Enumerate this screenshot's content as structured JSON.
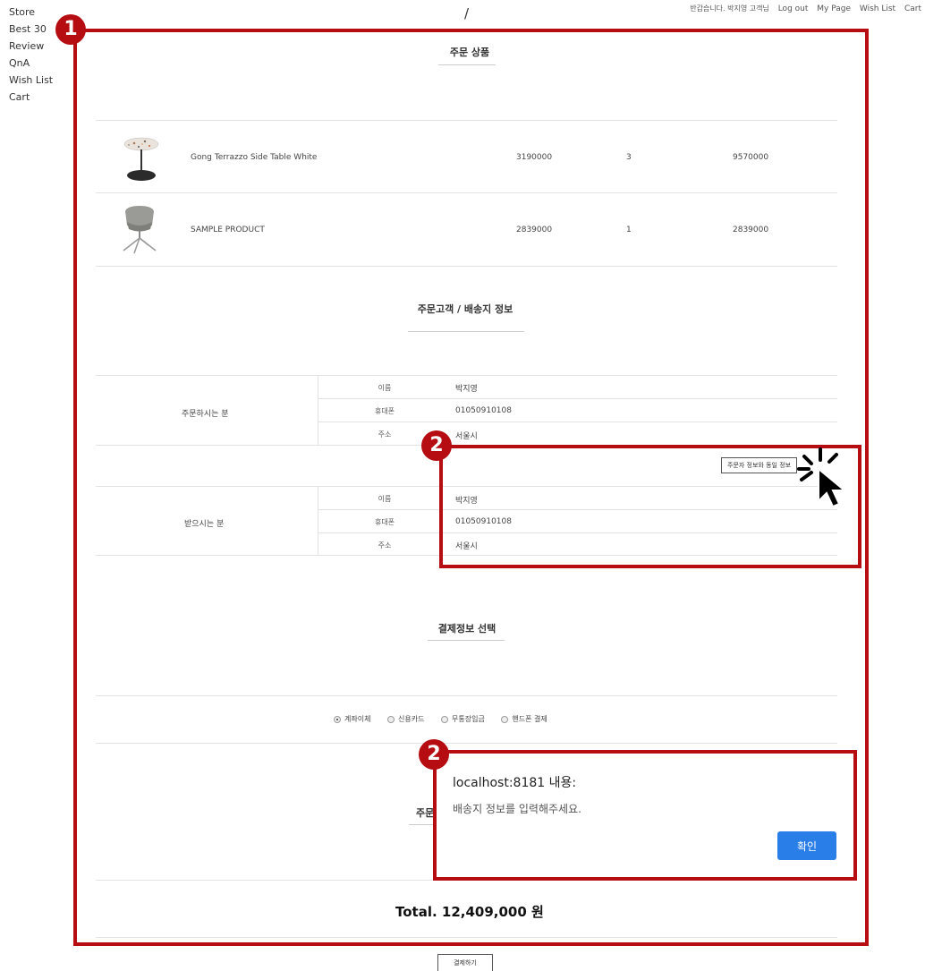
{
  "left_nav": [
    "Store",
    "Best 30",
    "Review",
    "QnA",
    "Wish List",
    "Cart"
  ],
  "logo": "/",
  "top_nav": {
    "greeting": "반갑습니다. 박지영 고객님",
    "links": [
      "Log out",
      "My Page",
      "Wish List",
      "Cart"
    ]
  },
  "order_products": {
    "title": "주문 상품",
    "items": [
      {
        "name": "Gong Terrazzo Side Table White",
        "price": "3190000",
        "qty": "3",
        "total": "9570000",
        "image_icon": "side-table-image"
      },
      {
        "name": "SAMPLE PRODUCT",
        "price": "2839000",
        "qty": "1",
        "total": "2839000",
        "image_icon": "chair-image"
      }
    ]
  },
  "customer_info": {
    "title": "주문고객 / 배송지 정보",
    "orderer": {
      "label": "주문하시는 분",
      "rows": [
        {
          "label": "이름",
          "value": "박지영"
        },
        {
          "label": "휴대폰",
          "value": "01050910108"
        },
        {
          "label": "주소",
          "value": "서울시"
        }
      ]
    },
    "same_button": "주문자 정보와 동일 정보",
    "receiver": {
      "label": "받으시는 분",
      "rows": [
        {
          "label": "이름",
          "value": "박지영"
        },
        {
          "label": "휴대폰",
          "value": "01050910108"
        },
        {
          "label": "주소",
          "value": "서울시"
        }
      ]
    }
  },
  "payment": {
    "title": "결제정보 선택",
    "options": [
      {
        "label": "계좌이체",
        "checked": true
      },
      {
        "label": "신용카드",
        "checked": false
      },
      {
        "label": "무통장입금",
        "checked": false
      },
      {
        "label": "핸드폰 결제",
        "checked": false
      }
    ]
  },
  "hidden_section_title_visible": "주문",
  "total": "Total. 12,409,000 원",
  "pay_button": "결제하기",
  "alert": {
    "title": "localhost:8181 내용:",
    "message": "배송지 정보를 입력해주세요.",
    "ok": "확인"
  },
  "annotations": {
    "badge1": "1",
    "badge2": "2",
    "color": "#b50d12"
  }
}
